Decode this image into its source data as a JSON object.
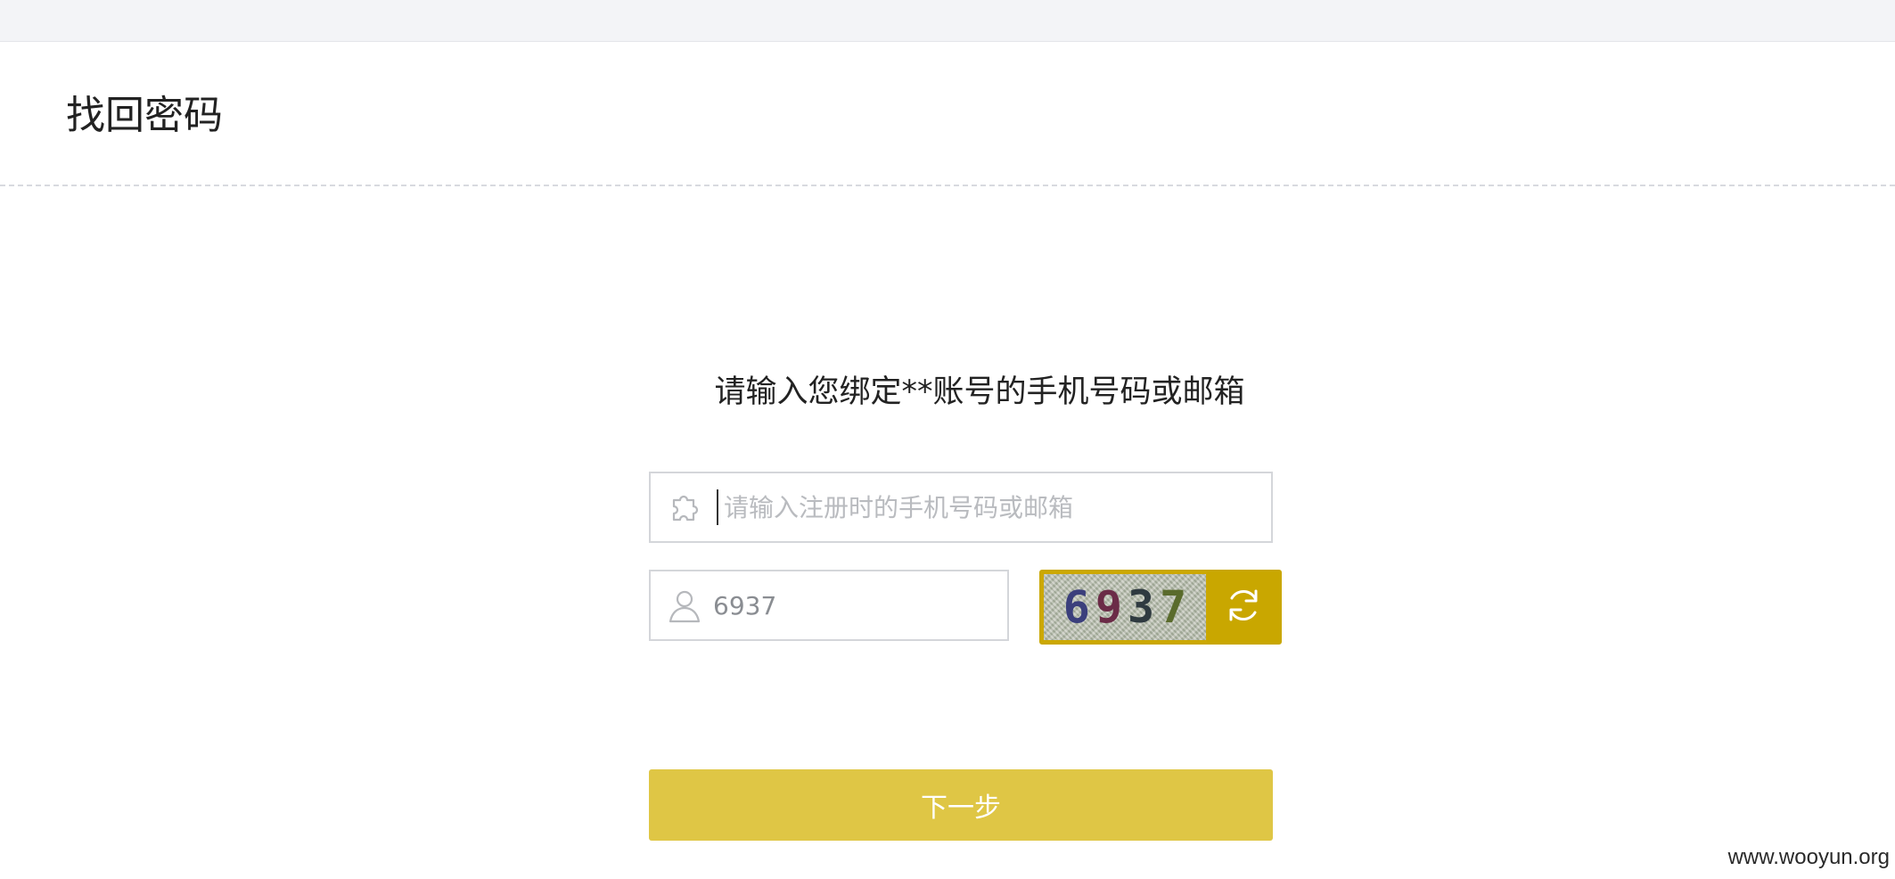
{
  "page": {
    "title": "找回密码"
  },
  "form": {
    "instruction": "请输入您绑定**账号的手机号码或邮箱",
    "account_field": {
      "placeholder": "请输入注册时的手机号码或邮箱",
      "value": "",
      "icon": "puzzle-icon"
    },
    "captcha_field": {
      "value": "6937",
      "icon": "user-icon"
    },
    "captcha_image": {
      "digits": [
        "6",
        "9",
        "3",
        "7"
      ],
      "refresh_icon": "refresh-icon"
    },
    "next_button_label": "下一步"
  },
  "watermark": "www.wooyun.org",
  "colors": {
    "accent": "#dfc645",
    "captcha_accent": "#c9a700",
    "border": "#d4d6da"
  }
}
